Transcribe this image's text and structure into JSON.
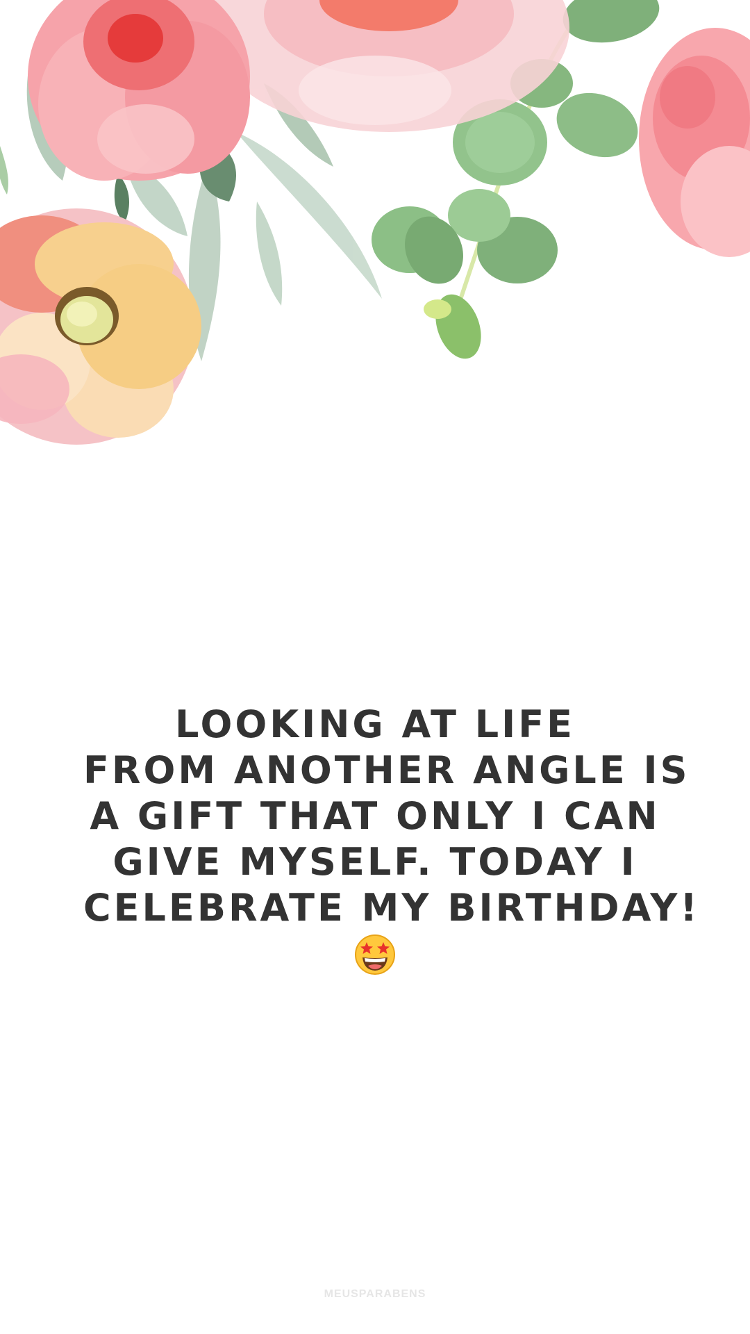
{
  "quote": {
    "lines": [
      "LOOKING AT LIFE",
      "FROM ANOTHER ANGLE IS",
      "A GIFT THAT ONLY I CAN",
      "GIVE MYSELF. TODAY I",
      "CELEBRATE MY BIRTHDAY!"
    ],
    "emoji": "star-struck-emoji"
  },
  "watermark": "MEUSPARABENS",
  "colors": {
    "background": "#ffffff",
    "text": "#333333",
    "watermark": "#e6e6e6",
    "rose_pink": "#f7a1a8",
    "rose_light": "#f8c9cc",
    "leaf_sage": "#b9cfbf",
    "leaf_green": "#7fb07a",
    "eucalyptus": "#a9cda2",
    "peach": "#f7d79a"
  }
}
